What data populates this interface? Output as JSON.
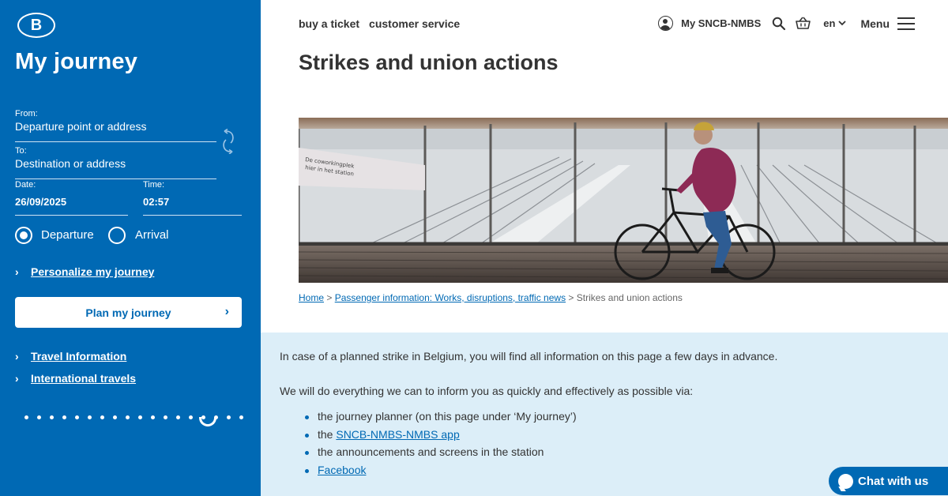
{
  "sidebar": {
    "logo_letter": "B",
    "title": "My journey",
    "from_label": "From:",
    "from_placeholder": "Departure point or address",
    "to_label": "To:",
    "to_placeholder": "Destination or address",
    "date_label": "Date:",
    "date_value": "26/09/2025",
    "time_label": "Time:",
    "time_value": "02:57",
    "radio_departure": "Departure",
    "radio_arrival": "Arrival",
    "radio_selected": "Departure",
    "personalize_link": "Personalize my journey",
    "plan_button": "Plan my journey",
    "links": [
      "Travel Information",
      "International travels"
    ]
  },
  "topnav": {
    "buy_ticket": "buy a ticket",
    "customer_service": "customer service",
    "my_account": "My SNCB-NMBS",
    "language": "en",
    "menu": "Menu"
  },
  "page_title": "Strikes and union actions",
  "hero_image": {
    "sign_text": [
      "De coworkingplek",
      "hier in het station"
    ]
  },
  "breadcrumb": {
    "home": "Home",
    "separator": ">",
    "parent": "Passenger information: Works, disruptions, traffic news",
    "current": "Strikes and union actions"
  },
  "info": {
    "intro": "In case of a planned strike in Belgium, you will find all information on this page a few days in advance.",
    "lead": "We will do everything we can to inform you as quickly and effectively as possible via:",
    "item1": "the journey planner (on this page under ‘My journey’)",
    "item2_prefix": "the ",
    "item2_link": "SNCB-NMBS-NMBS app",
    "item3": "the announcements and screens in the station",
    "item4_link": "Facebook"
  },
  "chat_button": "Chat with us",
  "colors": {
    "brand_blue": "#0069b4",
    "info_bg": "#dceef8"
  }
}
